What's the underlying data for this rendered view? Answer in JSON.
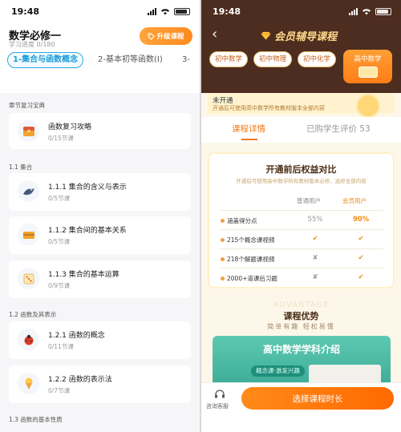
{
  "left": {
    "status": {
      "time": "19:48"
    },
    "header": {
      "back_glyph": "‹",
      "title": "数学必修一",
      "progress": "学习进度 0/180",
      "upgrade_label": "升级课程"
    },
    "tabs": [
      "1-集合与函数概念",
      "2-基本初等函数(Ⅰ)",
      "3-"
    ],
    "sections": [
      {
        "label": "章节复习宝典"
      },
      {
        "label": "1.1 集合"
      },
      {
        "label": "1.2 函数及其表示"
      },
      {
        "label": "1.3 函数的基本性质"
      }
    ],
    "cards": [
      {
        "title": "函数复习攻略",
        "sub": "0/15节课",
        "icon": "chest-icon"
      },
      {
        "title": "1.1.1 集合的含义与表示",
        "sub": "0/5节课",
        "icon": "bird-icon"
      },
      {
        "title": "1.1.2 集合间的基本关系",
        "sub": "0/5节课",
        "icon": "crate-icon"
      },
      {
        "title": "1.1.3 集合的基本运算",
        "sub": "0/9节课",
        "icon": "dice-icon"
      },
      {
        "title": "1.2.1 函数的概念",
        "sub": "0/11节课",
        "icon": "ladybug-icon"
      },
      {
        "title": "1.2.2 函数的表示法",
        "sub": "0/7节课",
        "icon": "icecream-icon"
      }
    ]
  },
  "right": {
    "status": {
      "time": "19:48"
    },
    "header": {
      "back_glyph": "‹",
      "title": "会员辅导课程"
    },
    "subjects": [
      "初中数学",
      "初中物理",
      "初中化学"
    ],
    "active_subject": "高中数学",
    "notice": {
      "title": "未开通",
      "desc": "开通后可使用高中数学所有教材版本全部内容"
    },
    "tabs": {
      "detail": "课程详情",
      "reviews": "已购学生评价 53"
    },
    "compare": {
      "title": "开通前后权益对比",
      "subtitle": "开通后可使用高中数学所有教材版本必修、选修全部内容",
      "col_normal": "普通用户",
      "col_member": "会员用户",
      "rows": [
        {
          "label": "涵盖得分点",
          "normal": "55%",
          "member": "90%"
        },
        {
          "label": "215个概念课视频",
          "normal": "✔",
          "member": "✔"
        },
        {
          "label": "218个解题课视频",
          "normal": "✘",
          "member": "✔"
        },
        {
          "label": "2000+道课后习题",
          "normal": "✘",
          "member": "✔"
        }
      ]
    },
    "advantage": {
      "watermark": "ADVANTAGE",
      "title": "课程优势",
      "subtitle": "简单有趣 轻松易懂"
    },
    "banner": {
      "title": "高中数学学科介绍",
      "pill": "概念课·激发兴趣"
    },
    "bottom": {
      "service_label": "咨询客服",
      "cta_label": "选择课程时长"
    }
  }
}
